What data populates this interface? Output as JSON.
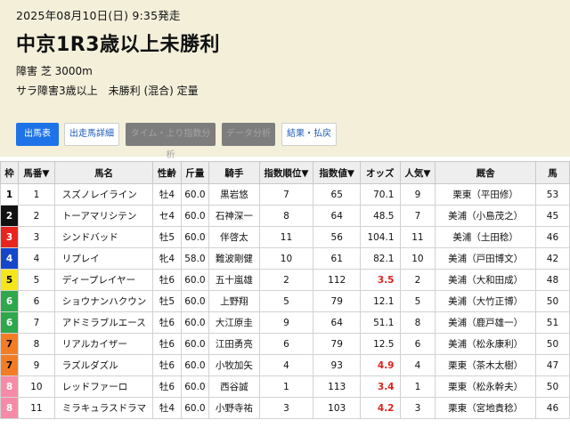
{
  "race": {
    "date": "2025年08月10日(日) 9:35発走",
    "title": "中京1R3歳以上未勝利",
    "course": "障害 芝 3000m",
    "conditions": "サラ障害3歳以上　未勝利 (混合) 定量"
  },
  "tabs": [
    {
      "label": "出馬表",
      "state": "active"
    },
    {
      "label": "出走馬詳細",
      "state": "normal"
    },
    {
      "label": "タイム・上り指数分析",
      "state": "disabled"
    },
    {
      "label": "データ分析",
      "state": "disabled"
    },
    {
      "label": "結果・払戻",
      "state": "normal"
    }
  ],
  "table": {
    "headers": [
      "枠",
      "馬番▼",
      "馬名",
      "性齢",
      "斤量",
      "騎手",
      "指数順位▼",
      "指数値▼",
      "オッズ",
      "人気▼",
      "厩舎",
      "馬"
    ],
    "rows": [
      {
        "waku": "1",
        "ban": "1",
        "name": "スズノレイライン",
        "sex": "牡4",
        "kin": "60.0",
        "jockey": "黒岩悠",
        "rank": "7",
        "idx": "65",
        "odds": "70.1",
        "pop": "9",
        "stable": "栗東（平田修）",
        "extra": "53"
      },
      {
        "waku": "2",
        "ban": "2",
        "name": "トーアマリシテン",
        "sex": "セ4",
        "kin": "60.0",
        "jockey": "石神深一",
        "rank": "8",
        "idx": "64",
        "odds": "48.5",
        "pop": "7",
        "stable": "美浦（小島茂之）",
        "extra": "45"
      },
      {
        "waku": "3",
        "ban": "3",
        "name": "シンドバッド",
        "sex": "牡5",
        "kin": "60.0",
        "jockey": "伴啓太",
        "rank": "11",
        "idx": "56",
        "odds": "104.1",
        "pop": "11",
        "stable": "美浦（土田稔）",
        "extra": "46"
      },
      {
        "waku": "4",
        "ban": "4",
        "name": "リプレイ",
        "sex": "牝4",
        "kin": "58.0",
        "jockey": "難波剛健",
        "rank": "10",
        "idx": "61",
        "odds": "82.1",
        "pop": "10",
        "stable": "美浦（戸田博文）",
        "extra": "42"
      },
      {
        "waku": "5",
        "ban": "5",
        "name": "ディープレイヤー",
        "sex": "牡6",
        "kin": "60.0",
        "jockey": "五十嵐雄",
        "rank": "2",
        "idx": "112",
        "odds": "3.5",
        "pop": "2",
        "stable": "美浦（大和田成）",
        "extra": "48"
      },
      {
        "waku": "6",
        "ban": "6",
        "name": "ショウナンハクウン",
        "sex": "牡5",
        "kin": "60.0",
        "jockey": "上野翔",
        "rank": "5",
        "idx": "79",
        "odds": "12.1",
        "pop": "5",
        "stable": "美浦（大竹正博）",
        "extra": "50"
      },
      {
        "waku": "6",
        "ban": "7",
        "name": "アドミラブルエース",
        "sex": "牡6",
        "kin": "60.0",
        "jockey": "大江原圭",
        "rank": "9",
        "idx": "64",
        "odds": "51.1",
        "pop": "8",
        "stable": "美浦（鹿戸雄一）",
        "extra": "51"
      },
      {
        "waku": "7",
        "ban": "8",
        "name": "リアルカイザー",
        "sex": "牡6",
        "kin": "60.0",
        "jockey": "江田勇亮",
        "rank": "6",
        "idx": "79",
        "odds": "12.5",
        "pop": "6",
        "stable": "美浦（松永康利）",
        "extra": "50"
      },
      {
        "waku": "7",
        "ban": "9",
        "name": "ラズルダズル",
        "sex": "牡6",
        "kin": "60.0",
        "jockey": "小牧加矢",
        "rank": "4",
        "idx": "93",
        "odds": "4.9",
        "pop": "4",
        "stable": "栗東（茶木太樹）",
        "extra": "47"
      },
      {
        "waku": "8",
        "ban": "10",
        "name": "レッドファーロ",
        "sex": "牡6",
        "kin": "60.0",
        "jockey": "西谷誠",
        "rank": "1",
        "idx": "113",
        "odds": "3.4",
        "pop": "1",
        "stable": "栗東（松永幹夫）",
        "extra": "50"
      },
      {
        "waku": "8",
        "ban": "11",
        "name": "ミラキュラスドラマ",
        "sex": "牡4",
        "kin": "60.0",
        "jockey": "小野寺祐",
        "rank": "3",
        "idx": "103",
        "odds": "4.2",
        "pop": "3",
        "stable": "栗東（宮地貴稔）",
        "extra": "46"
      }
    ]
  },
  "colors": {
    "header_bg": "#f4efd9",
    "tab_active": "#1e73e8",
    "tab_disabled": "#7d7d7d",
    "odds_hot": "#e0201c"
  }
}
